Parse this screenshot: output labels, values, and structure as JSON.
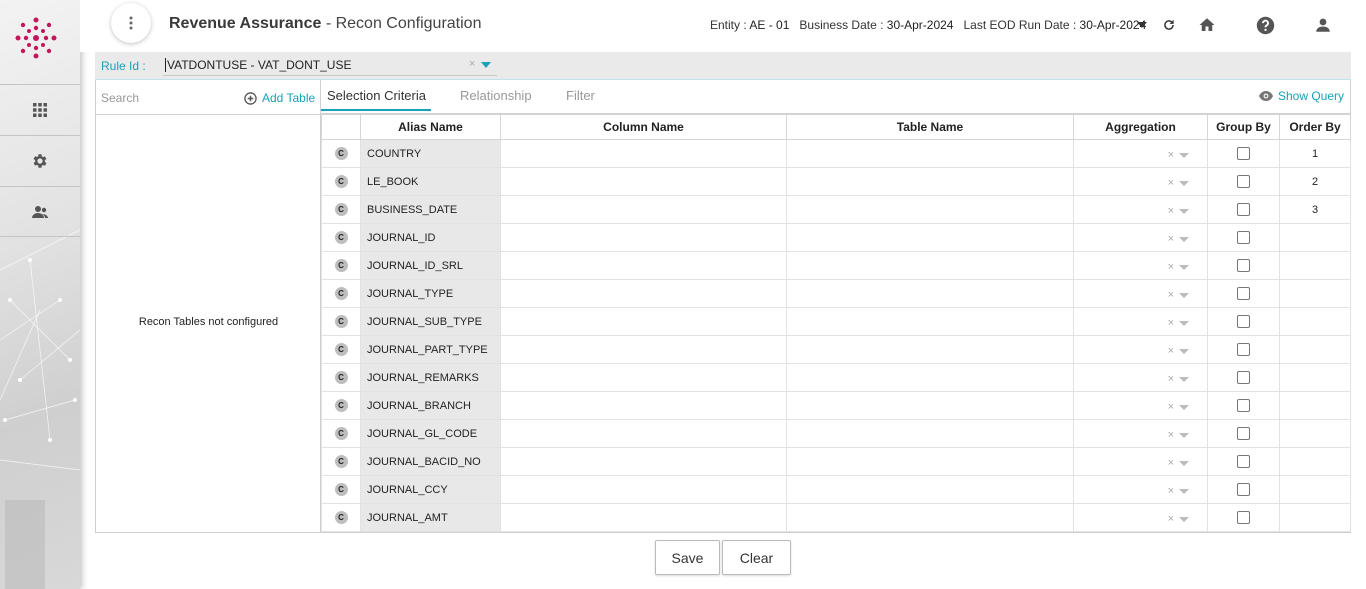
{
  "header": {
    "app_title": "Revenue Assurance",
    "sub_title": " - Recon Configuration",
    "entity_label": "Entity : ",
    "entity_value": "AE - 01",
    "business_date_label": "Business Date : ",
    "business_date_value": "30-Apr-2024",
    "eod_label": "Last EOD Run Date : ",
    "eod_value": "30-Apr-2024"
  },
  "rule": {
    "label": "Rule Id :",
    "value": "VATDONTUSE - VAT_DONT_USE",
    "clear": "×"
  },
  "left_panel": {
    "search_placeholder": "Search",
    "add_table_label": "Add Table",
    "empty_message": "Recon Tables not configured"
  },
  "tabs": [
    {
      "label": "Selection Criteria",
      "active": true
    },
    {
      "label": "Relationship",
      "active": false
    },
    {
      "label": "Filter",
      "active": false
    }
  ],
  "show_query_label": "Show Query",
  "grid": {
    "columns": [
      "Alias Name",
      "Column Name",
      "Table Name",
      "Aggregation",
      "Group By",
      "Order By"
    ],
    "badge": "C",
    "clear": "×",
    "rows": [
      {
        "alias": "COUNTRY",
        "order": "1"
      },
      {
        "alias": "LE_BOOK",
        "order": "2"
      },
      {
        "alias": "BUSINESS_DATE",
        "order": "3"
      },
      {
        "alias": "JOURNAL_ID",
        "order": ""
      },
      {
        "alias": "JOURNAL_ID_SRL",
        "order": ""
      },
      {
        "alias": "JOURNAL_TYPE",
        "order": ""
      },
      {
        "alias": "JOURNAL_SUB_TYPE",
        "order": ""
      },
      {
        "alias": "JOURNAL_PART_TYPE",
        "order": ""
      },
      {
        "alias": "JOURNAL_REMARKS",
        "order": ""
      },
      {
        "alias": "JOURNAL_BRANCH",
        "order": ""
      },
      {
        "alias": "JOURNAL_GL_CODE",
        "order": ""
      },
      {
        "alias": "JOURNAL_BACID_NO",
        "order": ""
      },
      {
        "alias": "JOURNAL_CCY",
        "order": ""
      },
      {
        "alias": "JOURNAL_AMT",
        "order": ""
      }
    ]
  },
  "buttons": {
    "save": "Save",
    "clear": "Clear"
  },
  "colors": {
    "accent": "#17a2b8",
    "logo": "#c2185b"
  },
  "icons": [
    "app-logo-icon",
    "apps-grid-icon",
    "gear-icon",
    "users-icon",
    "kebab-menu-icon",
    "dropdown-caret-icon",
    "refresh-icon",
    "home-icon",
    "help-icon",
    "user-icon",
    "add-circle-icon",
    "eye-icon"
  ]
}
